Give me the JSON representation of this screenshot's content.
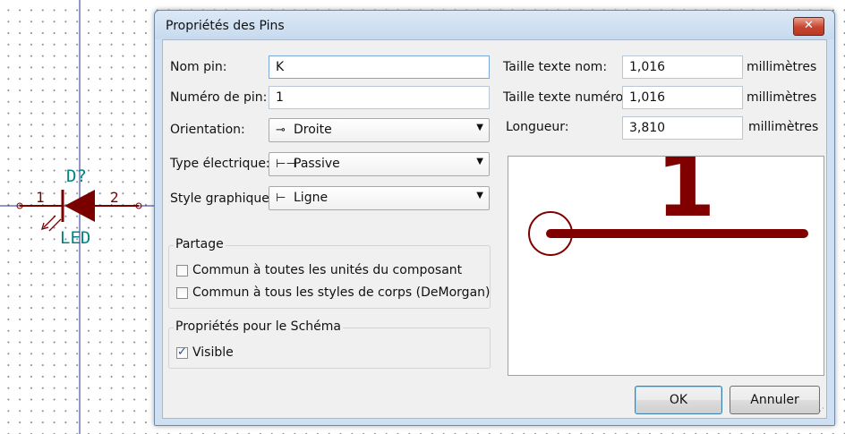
{
  "schematic": {
    "reference": "D?",
    "value": "LED",
    "pin1_number": "1",
    "pin2_number": "2",
    "color": "#7a0000",
    "text_color": "#008484"
  },
  "dialog": {
    "title": "Propriétés des Pins",
    "close_icon": "close-icon",
    "fields": {
      "pin_name_label": "Nom pin:",
      "pin_name_value": "K",
      "pin_number_label": "Numéro de pin:",
      "pin_number_value": "1",
      "orientation_label": "Orientation:",
      "orientation_value": "Droite",
      "electrical_type_label": "Type électrique:",
      "electrical_type_value": "Passive",
      "graphic_style_label": "Style graphique:",
      "graphic_style_value": "Ligne",
      "name_text_size_label": "Taille texte nom:",
      "name_text_size_value": "1,016",
      "number_text_size_label": "Taille texte numéro:",
      "number_text_size_value": "1,016",
      "length_label": "Longueur:",
      "length_value": "3,810",
      "units": "millimètres"
    },
    "sharing": {
      "title": "Partage",
      "all_units_label": "Commun à toutes les unités du composant",
      "all_units_checked": false,
      "all_styles_label": "Commun à tous les styles de corps  (DeMorgan)",
      "all_styles_checked": false
    },
    "schematic_props": {
      "title": "Propriétés pour le Schéma",
      "visible_label": "Visible",
      "visible_checked": true
    },
    "preview": {
      "pin_number": "1",
      "color": "#800000"
    },
    "buttons": {
      "ok": "OK",
      "cancel": "Annuler"
    }
  }
}
